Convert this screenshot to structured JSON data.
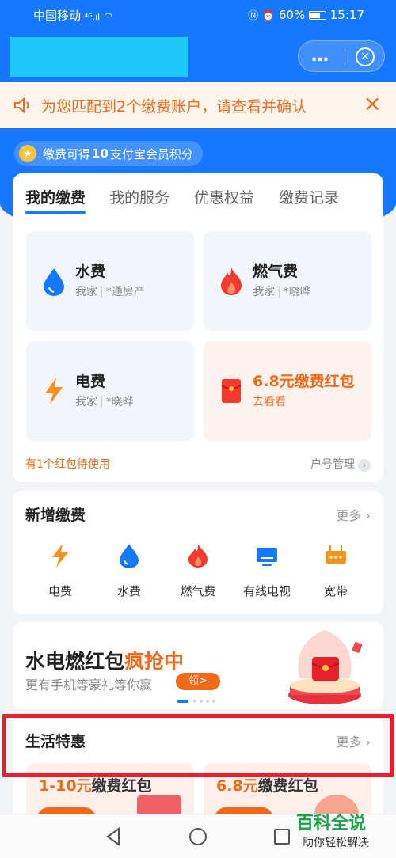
{
  "status_bar": {
    "carrier": "中国移动",
    "signal": "⁴ᴳ.ıl",
    "battery_text": "60%",
    "time": "15:17"
  },
  "title_bar": {
    "more_icon": "…",
    "close_icon": "⊗"
  },
  "notice": {
    "text": "为您匹配到2个缴费账户，请查看并确认",
    "close": "×"
  },
  "points": {
    "prefix": "缴费可得",
    "amount": "10",
    "suffix": "支付宝会员积分"
  },
  "tabs": [
    "我的缴费",
    "我的服务",
    "优惠权益",
    "缴费记录"
  ],
  "bills": [
    {
      "name": "水费",
      "owner": "我家",
      "account": "*通房产",
      "icon": "water-drop-icon"
    },
    {
      "name": "燃气费",
      "owner": "我家",
      "account": "*晓晔",
      "icon": "flame-icon"
    },
    {
      "name": "电费",
      "owner": "我家",
      "account": "*晓晔",
      "icon": "lightning-icon"
    }
  ],
  "red_packet": {
    "title": "6.8元缴费红包",
    "action": "去看看"
  },
  "main_footer": {
    "left": "有1个红包待使用",
    "right": "户号管理"
  },
  "add_section": {
    "title": "新增缴费",
    "more": "更多",
    "items": [
      "电费",
      "水费",
      "燃气费",
      "有线电视",
      "宽带"
    ]
  },
  "banner": {
    "title_normal": "水电燃红包",
    "title_highlight": "疯抢中",
    "subtitle": "更有手机等豪礼等你赢",
    "button": "领"
  },
  "life_section": {
    "title": "生活特惠",
    "more": "更多",
    "promos": [
      {
        "highlight": "1-10元",
        "text": "缴费红包"
      },
      {
        "highlight": "6.8元",
        "text": "缴费红包"
      }
    ]
  },
  "watermark": {
    "top": "百科全说",
    "bottom": "助你轻松解决"
  },
  "colors": {
    "brand_blue": "#1677ff",
    "accent_orange": "#f06a1a",
    "highlight_red": "#e8202a"
  }
}
